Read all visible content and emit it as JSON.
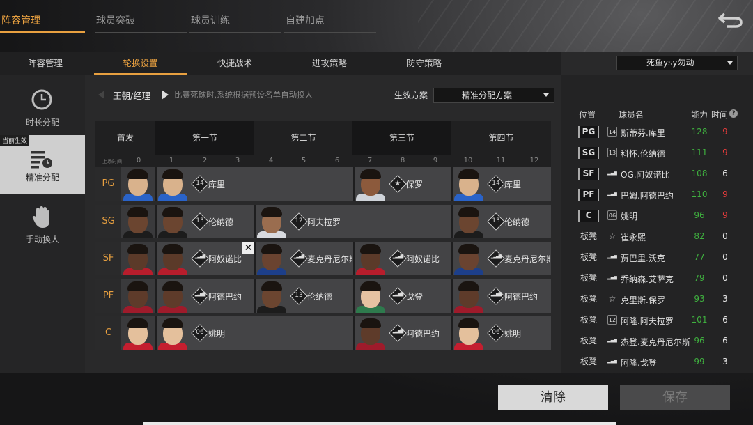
{
  "top_tabs": [
    "阵容管理",
    "球员突破",
    "球员训练",
    "自建加点"
  ],
  "sub_tabs": [
    "阵容管理",
    "轮换设置",
    "快捷战术",
    "进攻策略",
    "防守策略"
  ],
  "player_select": "死鱼ysy勿动",
  "side_menu": {
    "items": [
      "时长分配",
      "精准分配",
      "手动换人"
    ],
    "current_badge": "当前生效"
  },
  "team": "王朝/经理",
  "note": "比赛死球时,系统根据预设名单自动换人",
  "plan": {
    "label": "生效方案",
    "value": "精准分配方案"
  },
  "grid": {
    "start_label": "首发",
    "quarters": [
      "第一节",
      "第二节",
      "第三节",
      "第四节"
    ],
    "tick_label": "上场时间",
    "ticks": [
      "0",
      "1",
      "2",
      "3",
      "4",
      "5",
      "6",
      "7",
      "8",
      "9",
      "10",
      "11",
      "12"
    ]
  },
  "rotation": [
    {
      "pos": "PG",
      "starter": "库里",
      "segments": [
        {
          "badge": "14",
          "name": "库里"
        },
        {
          "badge": "star",
          "name": "保罗"
        },
        {
          "badge": "14",
          "name": "库里"
        }
      ]
    },
    {
      "pos": "SG",
      "starter": "伦纳德",
      "segments": [
        {
          "badge": "13",
          "name": "伦纳德"
        },
        {
          "badge": "12",
          "name": "阿夫拉罗"
        },
        {
          "badge": "13",
          "name": "伦纳德"
        }
      ]
    },
    {
      "pos": "SF",
      "starter": "阿奴诺比",
      "segments": [
        {
          "badge": "bars",
          "name": "阿奴诺比"
        },
        {
          "badge": "bars",
          "name": "麦克丹尼尔斯"
        },
        {
          "badge": "bars",
          "name": "阿奴诺比"
        },
        {
          "badge": "bars",
          "name": "麦克丹尼尔斯"
        }
      ]
    },
    {
      "pos": "PF",
      "starter": "阿德巴约",
      "segments": [
        {
          "badge": "bars",
          "name": "阿德巴约"
        },
        {
          "badge": "13",
          "name": "伦纳德"
        },
        {
          "badge": "bars",
          "name": "戈登"
        },
        {
          "badge": "bars",
          "name": "阿德巴约"
        }
      ]
    },
    {
      "pos": "C",
      "starter": "姚明",
      "segments": [
        {
          "badge": "06",
          "name": "姚明"
        },
        {
          "badge": "bars",
          "name": "阿德巴约"
        },
        {
          "badge": "06",
          "name": "姚明"
        }
      ]
    }
  ],
  "player_list": {
    "headers": {
      "pos": "位置",
      "name": "球员名",
      "rating": "能力",
      "time": "时间"
    },
    "players": [
      {
        "pos": "PG",
        "badge": "14",
        "name": "斯蒂芬.库里",
        "rating": "128",
        "time": "9"
      },
      {
        "pos": "SG",
        "badge": "13",
        "name": "科怀.伦纳德",
        "rating": "111",
        "time": "9"
      },
      {
        "pos": "SF",
        "badge": "bars",
        "name": "OG.阿奴诺比",
        "rating": "108",
        "time": "6"
      },
      {
        "pos": "PF",
        "badge": "bars",
        "name": "巴姆.阿德巴约",
        "rating": "110",
        "time": "9"
      },
      {
        "pos": "C",
        "badge": "06",
        "name": "姚明",
        "rating": "96",
        "time": "9"
      },
      {
        "pos": "板凳",
        "badge": "star",
        "name": "崔永熙",
        "rating": "82",
        "time": "0"
      },
      {
        "pos": "板凳",
        "badge": "bars",
        "name": "贾巴里.沃克",
        "rating": "77",
        "time": "0"
      },
      {
        "pos": "板凳",
        "badge": "bars",
        "name": "乔纳森.艾萨克",
        "rating": "79",
        "time": "0"
      },
      {
        "pos": "板凳",
        "badge": "star",
        "name": "克里斯.保罗",
        "rating": "93",
        "time": "3"
      },
      {
        "pos": "板凳",
        "badge": "12",
        "name": "阿隆.阿夫拉罗",
        "rating": "101",
        "time": "6"
      },
      {
        "pos": "板凳",
        "badge": "bars",
        "name": "杰登.麦克丹尼尔斯",
        "rating": "96",
        "time": "6"
      },
      {
        "pos": "板凳",
        "badge": "bars",
        "name": "阿隆.戈登",
        "rating": "99",
        "time": "3"
      }
    ]
  },
  "buttons": {
    "clear": "清除",
    "save": "保存"
  },
  "colors": {
    "accent": "#e8a040",
    "rating": "#3fb03f",
    "time_full": "#e43b3b"
  }
}
